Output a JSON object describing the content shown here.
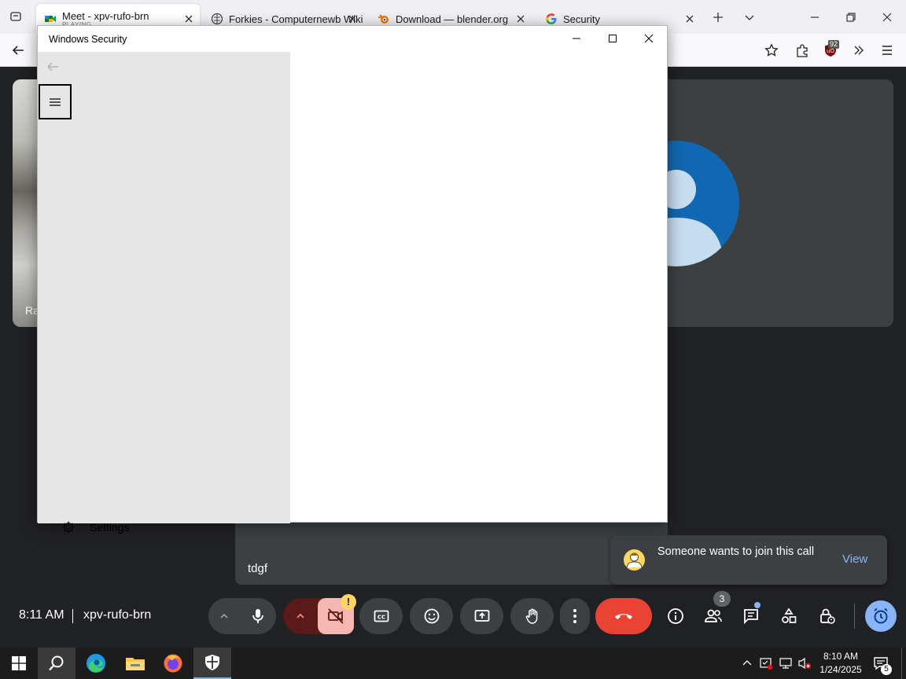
{
  "browser": {
    "tabs": [
      {
        "title": "Meet - xpv-rufo-brn",
        "subtitle": "PLAYING",
        "icon": "google-meet-icon",
        "active": true
      },
      {
        "title": "Forkies - Computernewb Wiki",
        "icon": "wiki-icon"
      },
      {
        "title": "Download — blender.org",
        "icon": "blender-icon"
      },
      {
        "title": "Security",
        "icon": "google-icon"
      }
    ],
    "extension_badge": "92"
  },
  "security_window": {
    "title": "Windows Security",
    "settings_label": "Settings"
  },
  "meet": {
    "participant_tile_label": "Ra",
    "caption_text": "tdgf",
    "toast": {
      "message": "Someone wants to join this call",
      "action": "View"
    },
    "time": "8:11 AM",
    "meeting_code": "xpv-rufo-brn",
    "camera_warning": "!",
    "people_count": "3",
    "colors": {
      "end_call": "#ea4335",
      "accent": "#8ab4f8",
      "camera_off": "#f5b7b1",
      "mic_up": "#5a1a17"
    }
  },
  "taskbar": {
    "time": "8:10 AM",
    "date": "1/24/2025",
    "notification_count": "5"
  }
}
